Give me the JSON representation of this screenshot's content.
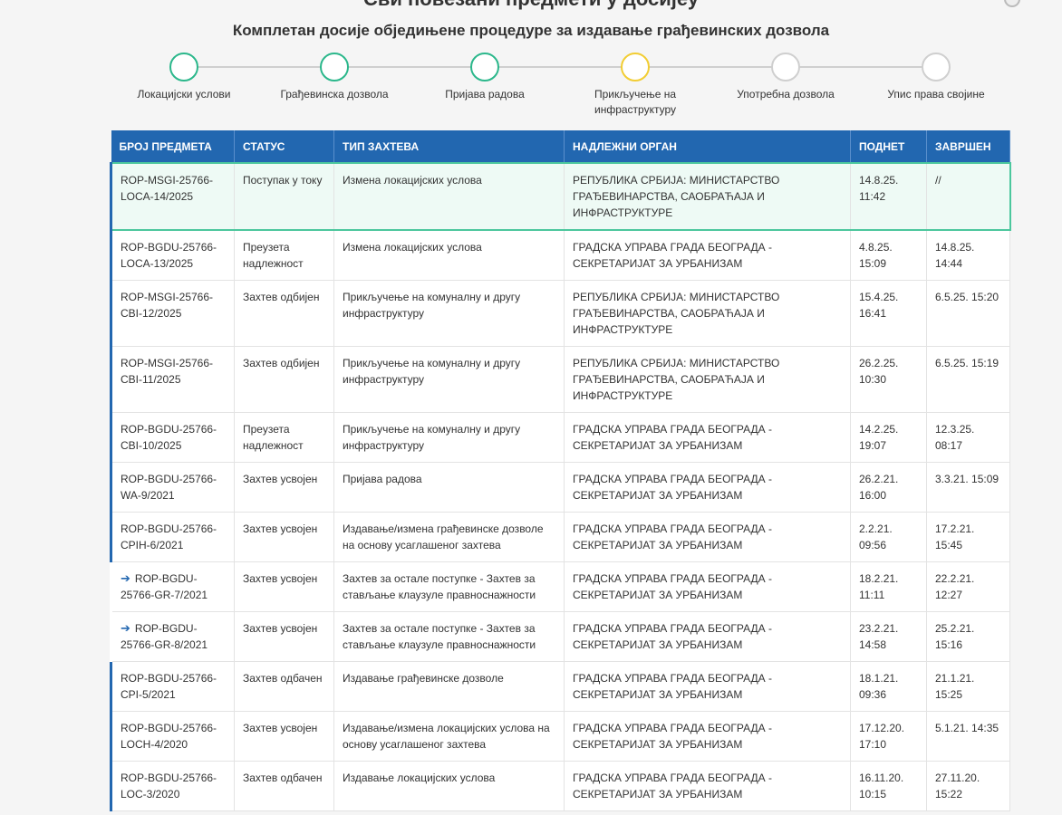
{
  "header": {
    "title": "Сви повезани предмети у досијеу",
    "subtitle": "Комплетан досије обједињене процедуре за издавање грађевинских дозвола"
  },
  "steps": [
    {
      "label": "Локацијски услови",
      "state": "done"
    },
    {
      "label": "Грађевинска дозвола",
      "state": "done"
    },
    {
      "label": "Пријава радова",
      "state": "done"
    },
    {
      "label": "Прикључење на инфраструктуру",
      "state": "active"
    },
    {
      "label": "Употребна дозвола",
      "state": "todo"
    },
    {
      "label": "Упис права својине",
      "state": "todo"
    }
  ],
  "table": {
    "columns": [
      "БРОЈ ПРЕДМЕТА",
      "СТАТУС",
      "ТИП ЗАХТЕВА",
      "НАДЛЕЖНИ ОРГАН",
      "ПОДНЕТ",
      "ЗАВРШЕН"
    ],
    "rows": [
      {
        "id": "ROP-MSGI-25766-LOCA-14/2025",
        "status": "Поступак у току",
        "type": "Измена локацијских услова",
        "authority": "РЕПУБЛИКА СРБИЈА: МИНИСТАРСТВО ГРАЂЕВИНАРСТВА, САОБРАЋАЈА И ИНФРАСТРУКТУРЕ",
        "submitted": "14.8.25. 11:42",
        "completed": "//",
        "current": true,
        "linked": false
      },
      {
        "id": "ROP-BGDU-25766-LOCA-13/2025",
        "status": "Преузета надлежност",
        "type": "Измена локацијских услова",
        "authority": "ГРАДСКА УПРАВА ГРАДА БЕОГРАДА - СЕКРЕТАРИЈАТ ЗА УРБАНИЗАМ",
        "submitted": "4.8.25. 15:09",
        "completed": "14.8.25. 14:44",
        "current": false,
        "linked": false
      },
      {
        "id": "ROP-MSGI-25766-CBI-12/2025",
        "status": "Захтев одбијен",
        "type": "Прикључење на комуналну и другу инфраструктуру",
        "authority": "РЕПУБЛИКА СРБИЈА: МИНИСТАРСТВО ГРАЂЕВИНАРСТВА, САОБРАЋАЈА И ИНФРАСТРУКТУРЕ",
        "submitted": "15.4.25. 16:41",
        "completed": "6.5.25. 15:20",
        "current": false,
        "linked": false
      },
      {
        "id": "ROP-MSGI-25766-CBI-11/2025",
        "status": "Захтев одбијен",
        "type": "Прикључење на комуналну и другу инфраструктуру",
        "authority": "РЕПУБЛИКА СРБИЈА: МИНИСТАРСТВО ГРАЂЕВИНАРСТВА, САОБРАЋАЈА И ИНФРАСТРУКТУРЕ",
        "submitted": "26.2.25. 10:30",
        "completed": "6.5.25. 15:19",
        "current": false,
        "linked": false
      },
      {
        "id": "ROP-BGDU-25766-CBI-10/2025",
        "status": "Преузета надлежност",
        "type": "Прикључење на комуналну и другу инфраструктуру",
        "authority": "ГРАДСКА УПРАВА ГРАДА БЕОГРАДА - СЕКРЕТАРИЈАТ ЗА УРБАНИЗАМ",
        "submitted": "14.2.25. 19:07",
        "completed": "12.3.25. 08:17",
        "current": false,
        "linked": false
      },
      {
        "id": "ROP-BGDU-25766-WA-9/2021",
        "status": "Захтев усвојен",
        "type": "Пријава радова",
        "authority": "ГРАДСКА УПРАВА ГРАДА БЕОГРАДА - СЕКРЕТАРИЈАТ ЗА УРБАНИЗАМ",
        "submitted": "26.2.21. 16:00",
        "completed": "3.3.21. 15:09",
        "current": false,
        "linked": false
      },
      {
        "id": "ROP-BGDU-25766-CPIH-6/2021",
        "status": "Захтев усвојен",
        "type": "Издавање/измена грађевинске дозволе на основу усаглашеног захтева",
        "authority": "ГРАДСКА УПРАВА ГРАДА БЕОГРАДА - СЕКРЕТАРИЈАТ ЗА УРБАНИЗАМ",
        "submitted": "2.2.21. 09:56",
        "completed": "17.2.21. 15:45",
        "current": false,
        "linked": false
      },
      {
        "id": "ROP-BGDU-25766-GR-7/2021",
        "status": "Захтев усвојен",
        "type": "Захтев за остале поступке - Захтев за стављање клаузуле правноснажности",
        "authority": "ГРАДСКА УПРАВА ГРАДА БЕОГРАДА - СЕКРЕТАРИЈАТ ЗА УРБАНИЗАМ",
        "submitted": "18.2.21. 11:11",
        "completed": "22.2.21. 12:27",
        "current": false,
        "linked": true
      },
      {
        "id": "ROP-BGDU-25766-GR-8/2021",
        "status": "Захтев усвојен",
        "type": "Захтев за остале поступке - Захтев за стављање клаузуле правноснажности",
        "authority": "ГРАДСКА УПРАВА ГРАДА БЕОГРАДА - СЕКРЕТАРИЈАТ ЗА УРБАНИЗАМ",
        "submitted": "23.2.21. 14:58",
        "completed": "25.2.21. 15:16",
        "current": false,
        "linked": true
      },
      {
        "id": "ROP-BGDU-25766-CPI-5/2021",
        "status": "Захтев одбачен",
        "type": "Издавање грађевинске дозволе",
        "authority": "ГРАДСКА УПРАВА ГРАДА БЕОГРАДА - СЕКРЕТАРИЈАТ ЗА УРБАНИЗАМ",
        "submitted": "18.1.21. 09:36",
        "completed": "21.1.21. 15:25",
        "current": false,
        "linked": false
      },
      {
        "id": "ROP-BGDU-25766-LOCH-4/2020",
        "status": "Захтев усвојен",
        "type": "Издавање/измена локацијских услова на основу усаглашеног захтева",
        "authority": "ГРАДСКА УПРАВА ГРАДА БЕОГРАДА - СЕКРЕТАРИЈАТ ЗА УРБАНИЗАМ",
        "submitted": "17.12.20. 17:10",
        "completed": "5.1.21. 14:35",
        "current": false,
        "linked": false
      },
      {
        "id": "ROP-BGDU-25766-LOC-3/2020",
        "status": "Захтев одбачен",
        "type": "Издавање локацијских услова",
        "authority": "ГРАДСКА УПРАВА ГРАДА БЕОГРАДА - СЕКРЕТАРИЈАТ ЗА УРБАНИЗАМ",
        "submitted": "16.11.20. 10:15",
        "completed": "27.11.20. 15:22",
        "current": false,
        "linked": false
      }
    ]
  },
  "colors": {
    "header_bg": "#2267b0",
    "done": "#2bb78b",
    "active": "#f2cd33",
    "todo": "#cfcfcf",
    "current_row": "#eefaf5"
  },
  "icons": {
    "linked_row": "arrow-right-icon"
  }
}
